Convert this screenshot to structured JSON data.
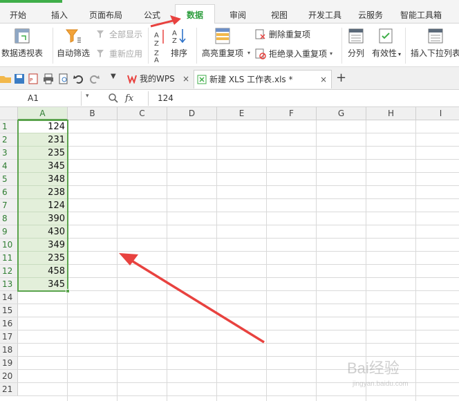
{
  "menu": {
    "tabs": [
      "开始",
      "插入",
      "页面布局",
      "公式",
      "数据",
      "审阅",
      "视图",
      "开发工具",
      "云服务",
      "智能工具箱"
    ],
    "active": "数据"
  },
  "ribbon": {
    "pivot": "数据透视表",
    "autofilter": "自动筛选",
    "show_all": "全部显示",
    "reapply": "重新应用",
    "sort": "排序",
    "highlight_dup": "高亮重复项",
    "remove_dup": "删除重复项",
    "reject_dup": "拒绝录入重复项",
    "split": "分列",
    "validation": "有效性",
    "insert_dropdown": "插入下拉列表"
  },
  "doc_tabs": [
    {
      "label": "我的WPS",
      "close": "×"
    },
    {
      "label": "新建 XLS 工作表.xls *",
      "close": "×"
    }
  ],
  "add_tab": "+",
  "formula_bar": {
    "cell_ref": "A1",
    "fx": "fx",
    "value": "124"
  },
  "columns": [
    "A",
    "B",
    "C",
    "D",
    "E",
    "F",
    "G",
    "H",
    "I"
  ],
  "rows": [
    "1",
    "2",
    "3",
    "4",
    "5",
    "6",
    "7",
    "8",
    "9",
    "10",
    "11",
    "12",
    "13",
    "14",
    "15",
    "16",
    "17",
    "18",
    "19",
    "20",
    "21"
  ],
  "column_a_values": [
    "124",
    "231",
    "235",
    "345",
    "348",
    "238",
    "124",
    "390",
    "430",
    "349",
    "235",
    "458",
    "345"
  ],
  "watermark": {
    "brand": "Bai经验",
    "sub": "jingyan.baidu.com"
  },
  "colors": {
    "accent": "#3fae49",
    "selection_fill": "#e3efda",
    "arrow": "#e8423f"
  }
}
